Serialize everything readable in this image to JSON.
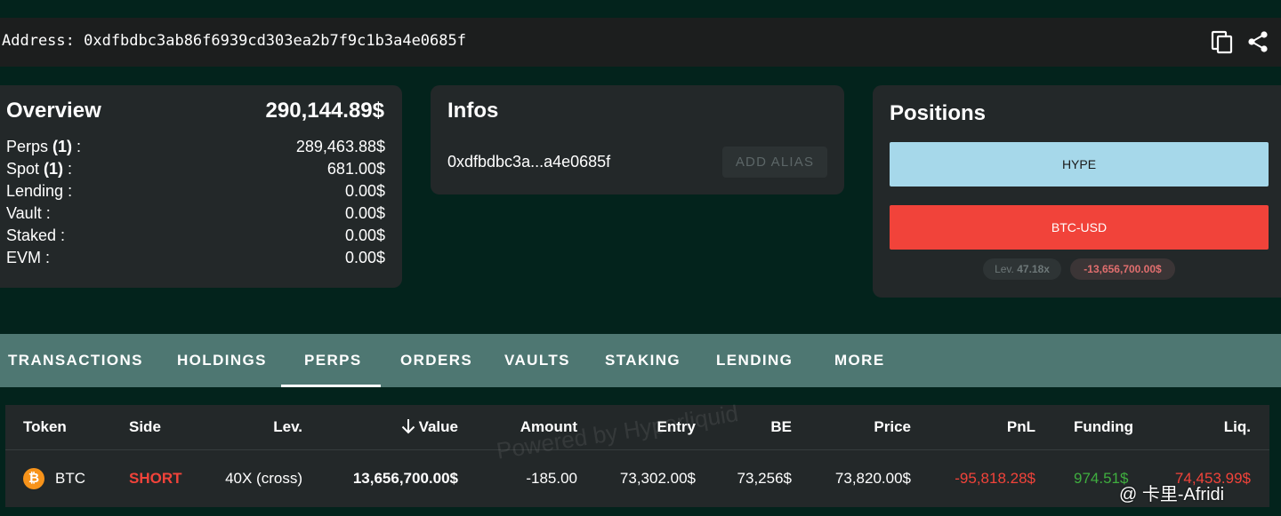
{
  "address_bar": {
    "text": "Address: 0xdfbdbc3ab86f6939cd303ea2b7f9c1b3a4e0685f"
  },
  "overview": {
    "title": "Overview",
    "total": "290,144.89$",
    "rows": [
      {
        "label": "Perps",
        "count": "(1)",
        "suffix": " :",
        "value": "289,463.88$"
      },
      {
        "label": "Spot",
        "count": "(1)",
        "suffix": " :",
        "value": "681.00$"
      },
      {
        "label": "Lending :",
        "count": "",
        "suffix": "",
        "value": "0.00$"
      },
      {
        "label": "Vault :",
        "count": "",
        "suffix": "",
        "value": "0.00$"
      },
      {
        "label": "Staked :",
        "count": "",
        "suffix": "",
        "value": "0.00$"
      },
      {
        "label": "EVM :",
        "count": "",
        "suffix": "",
        "value": "0.00$"
      }
    ]
  },
  "infos": {
    "title": "Infos",
    "address_short": "0xdfbdbc3a...a4e0685f",
    "alias_button": "ADD ALIAS"
  },
  "positions": {
    "title": "Positions",
    "items": [
      "HYPE",
      "BTC-USD"
    ],
    "lev_label": "Lev.",
    "lev_value": "47.18x",
    "pnl": "-13,656,700.00$"
  },
  "tabs": [
    "TRANSACTIONS",
    "HOLDINGS",
    "PERPS",
    "ORDERS",
    "VAULTS",
    "STAKING",
    "LENDING",
    "MORE"
  ],
  "active_tab": "PERPS",
  "table": {
    "headers": {
      "token": "Token",
      "side": "Side",
      "lev": "Lev.",
      "value": "Value",
      "amount": "Amount",
      "entry": "Entry",
      "be": "BE",
      "price": "Price",
      "pnl": "PnL",
      "funding": "Funding",
      "liq": "Liq."
    },
    "rows": [
      {
        "token": "BTC",
        "side": "SHORT",
        "lev": "40X (cross)",
        "value": "13,656,700.00$",
        "amount": "-185.00",
        "entry": "73,302.00$",
        "be": "73,256$",
        "price": "73,820.00$",
        "pnl": "-95,818.28$",
        "funding": "974.51$",
        "liq": "74,453.99$"
      }
    ]
  },
  "watermark": "Powered by Hyperliquid",
  "corner_watermark": "@ 卡里-Afridi",
  "colors": {
    "page_bg": "#03231c",
    "card_bg": "#232829",
    "tab_bar": "#4e7772",
    "hype_button": "#a6d8ea",
    "btc_button": "#f1433a",
    "negative": "#f1433a",
    "positive": "#3fae3f"
  }
}
